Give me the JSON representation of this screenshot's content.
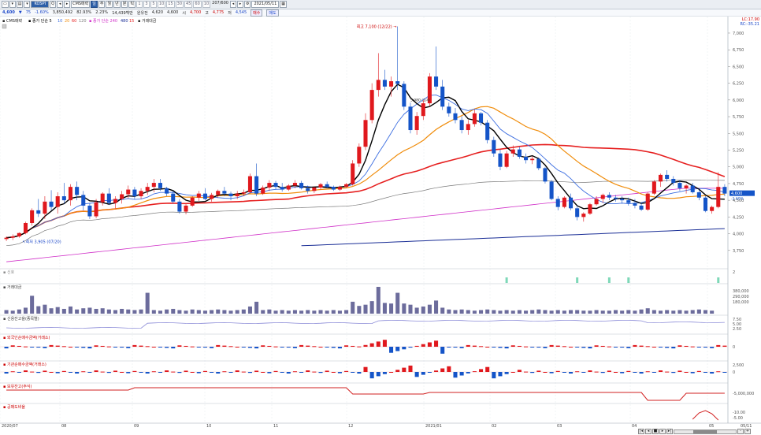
{
  "toolbar": {
    "symbol": "KOSPI",
    "kind": "CMS매략",
    "periods": [
      "1",
      "3",
      "5",
      "10",
      "15",
      "30",
      "45",
      "60",
      "10"
    ],
    "count": "207/600",
    "date": "2021/05/11",
    "dropdown_arrow": "▾"
  },
  "quote": {
    "price": "4,600",
    "direction": "▼",
    "change": "75",
    "pct": "-1.60%",
    "volume": "3,850,492",
    "vol_pct": "82.93%",
    "amount": "2.23%",
    "turnover": "14,439백만",
    "open_label": "원유전",
    "open": "4,620",
    "open2": "4,600",
    "high_label": "시",
    "high": "4,700",
    "low_label": "고",
    "low": "4,775",
    "close_label": "저",
    "close": "4,545",
    "btn1": "매도",
    "btn2": "매수"
  },
  "chart_data": {
    "type": "candlestick",
    "title": "CMS매략",
    "ylim": [
      3500,
      7200
    ],
    "yticks": [
      "7,000",
      "6,750",
      "6,500",
      "6,250",
      "6,000",
      "5,750",
      "5,500",
      "5,250",
      "5,000",
      "4,750",
      "4,500",
      "4,250",
      "4,000",
      "3,750"
    ],
    "ylim_note": "",
    "legend": [
      "CMS매략",
      "종가 단순 5",
      "10",
      "20",
      "60",
      "120",
      "종가 단순 240",
      "480",
      "15",
      "거래대금"
    ],
    "annotations": {
      "max": "최고 7,100 (12/22)",
      "min": "최저 3,905 (07/20)",
      "mid": "5,980 (1/4)"
    },
    "right_labels": [
      "LC:17.90",
      "RC:-35.21"
    ],
    "current_price_tag": "4,600",
    "current_pct_tag": "-1.60%",
    "x_labels": [
      "2020/07",
      "08",
      "09",
      "10",
      "11",
      "12",
      "2021/01",
      "02",
      "03",
      "04",
      "05",
      "05/11"
    ],
    "ohlc": [
      [
        3920,
        3960,
        3890,
        3940
      ],
      [
        3940,
        3990,
        3905,
        3960
      ],
      [
        3960,
        4020,
        3940,
        4010
      ],
      [
        4010,
        4180,
        3990,
        4160
      ],
      [
        4160,
        4380,
        4120,
        4350
      ],
      [
        4350,
        4520,
        4250,
        4300
      ],
      [
        4300,
        4560,
        4220,
        4480
      ],
      [
        4480,
        4650,
        4350,
        4400
      ],
      [
        4400,
        4620,
        4300,
        4560
      ],
      [
        4560,
        4760,
        4450,
        4500
      ],
      [
        4500,
        4740,
        4420,
        4700
      ],
      [
        4700,
        4780,
        4500,
        4580
      ],
      [
        4580,
        4640,
        4350,
        4420
      ],
      [
        4420,
        4460,
        4220,
        4260
      ],
      [
        4260,
        4520,
        4230,
        4470
      ],
      [
        4470,
        4620,
        4420,
        4600
      ],
      [
        4600,
        4680,
        4430,
        4460
      ],
      [
        4460,
        4560,
        4380,
        4520
      ],
      [
        4520,
        4640,
        4450,
        4590
      ],
      [
        4590,
        4720,
        4530,
        4660
      ],
      [
        4660,
        4700,
        4520,
        4560
      ],
      [
        4560,
        4680,
        4520,
        4640
      ],
      [
        4640,
        4760,
        4580,
        4700
      ],
      [
        4700,
        4820,
        4620,
        4760
      ],
      [
        4760,
        4820,
        4640,
        4680
      ],
      [
        4680,
        4700,
        4560,
        4600
      ],
      [
        4600,
        4640,
        4450,
        4480
      ],
      [
        4480,
        4520,
        4300,
        4330
      ],
      [
        4330,
        4440,
        4290,
        4420
      ],
      [
        4420,
        4560,
        4400,
        4540
      ],
      [
        4540,
        4640,
        4490,
        4600
      ],
      [
        4600,
        4680,
        4500,
        4520
      ],
      [
        4520,
        4610,
        4480,
        4580
      ],
      [
        4580,
        4660,
        4540,
        4640
      ],
      [
        4640,
        4700,
        4560,
        4600
      ],
      [
        4600,
        4630,
        4500,
        4560
      ],
      [
        4560,
        4640,
        4520,
        4600
      ],
      [
        4600,
        4660,
        4560,
        4620
      ],
      [
        4620,
        4900,
        4600,
        4860
      ],
      [
        4860,
        5050,
        4560,
        4600
      ],
      [
        4600,
        4720,
        4580,
        4690
      ],
      [
        4690,
        4800,
        4640,
        4760
      ],
      [
        4760,
        4790,
        4660,
        4700
      ],
      [
        4700,
        4760,
        4630,
        4660
      ],
      [
        4660,
        4740,
        4640,
        4720
      ],
      [
        4720,
        4800,
        4680,
        4760
      ],
      [
        4760,
        4790,
        4660,
        4680
      ],
      [
        4680,
        4720,
        4600,
        4640
      ],
      [
        4640,
        4700,
        4610,
        4690
      ],
      [
        4690,
        4760,
        4660,
        4740
      ],
      [
        4740,
        4780,
        4680,
        4700
      ],
      [
        4700,
        4720,
        4640,
        4660
      ],
      [
        4660,
        4720,
        4640,
        4700
      ],
      [
        4700,
        4760,
        4690,
        4740
      ],
      [
        4740,
        5100,
        4720,
        5050
      ],
      [
        5050,
        5350,
        5000,
        5300
      ],
      [
        5300,
        5800,
        5250,
        5700
      ],
      [
        5700,
        6250,
        5650,
        6150
      ],
      [
        6150,
        6700,
        6050,
        6300
      ],
      [
        6300,
        6450,
        6150,
        6200
      ],
      [
        6200,
        6350,
        6050,
        6280
      ],
      [
        6280,
        7100,
        6150,
        6240
      ],
      [
        6240,
        6280,
        5850,
        5900
      ],
      [
        5900,
        5960,
        5500,
        5550
      ],
      [
        5550,
        5820,
        5480,
        5760
      ],
      [
        5760,
        6000,
        5700,
        5950
      ],
      [
        5950,
        6400,
        5900,
        6350
      ],
      [
        6350,
        6800,
        6150,
        6200
      ],
      [
        6200,
        6300,
        5850,
        5900
      ],
      [
        5900,
        5960,
        5750,
        5800
      ],
      [
        5800,
        5880,
        5650,
        5700
      ],
      [
        5700,
        5760,
        5500,
        5550
      ],
      [
        5550,
        5700,
        5480,
        5640
      ],
      [
        5640,
        5860,
        5600,
        5800
      ],
      [
        5800,
        5820,
        5620,
        5660
      ],
      [
        5660,
        5700,
        5350,
        5400
      ],
      [
        5400,
        5450,
        5150,
        5200
      ],
      [
        5200,
        5260,
        4950,
        5000
      ],
      [
        5000,
        5240,
        4980,
        5200
      ],
      [
        5200,
        5320,
        5150,
        5260
      ],
      [
        5260,
        5300,
        5120,
        5150
      ],
      [
        5150,
        5200,
        5050,
        5100
      ],
      [
        5100,
        5160,
        5040,
        5120
      ],
      [
        5120,
        5140,
        4950,
        4980
      ],
      [
        4980,
        5000,
        4750,
        4780
      ],
      [
        4780,
        4800,
        4500,
        4520
      ],
      [
        4520,
        4560,
        4350,
        4400
      ],
      [
        4400,
        4560,
        4380,
        4540
      ],
      [
        4540,
        4600,
        4350,
        4380
      ],
      [
        4380,
        4420,
        4200,
        4250
      ],
      [
        4250,
        4320,
        4180,
        4300
      ],
      [
        4300,
        4460,
        4280,
        4440
      ],
      [
        4440,
        4560,
        4420,
        4520
      ],
      [
        4520,
        4600,
        4460,
        4580
      ],
      [
        4580,
        4620,
        4500,
        4540
      ],
      [
        4540,
        4580,
        4480,
        4520
      ],
      [
        4520,
        4560,
        4450,
        4500
      ],
      [
        4500,
        4540,
        4420,
        4460
      ],
      [
        4460,
        4520,
        4380,
        4420
      ],
      [
        4420,
        4470,
        4340,
        4360
      ],
      [
        4360,
        4620,
        4340,
        4600
      ],
      [
        4600,
        4800,
        4580,
        4780
      ],
      [
        4780,
        4900,
        4700,
        4880
      ],
      [
        4880,
        4950,
        4780,
        4820
      ],
      [
        4820,
        4860,
        4720,
        4760
      ],
      [
        4760,
        4800,
        4640,
        4680
      ],
      [
        4680,
        4740,
        4600,
        4720
      ],
      [
        4720,
        4760,
        4600,
        4620
      ],
      [
        4620,
        4660,
        4500,
        4540
      ],
      [
        4540,
        4560,
        4320,
        4340
      ],
      [
        4340,
        4420,
        4300,
        4400
      ],
      [
        4400,
        4920,
        4380,
        4700
      ],
      [
        4700,
        4740,
        4560,
        4600
      ]
    ],
    "volume": [
      12,
      10,
      14,
      20,
      60,
      25,
      30,
      18,
      22,
      16,
      24,
      14,
      18,
      20,
      16,
      18,
      14,
      12,
      16,
      14,
      12,
      14,
      70,
      12,
      10,
      14,
      16,
      12,
      10,
      14,
      12,
      10,
      12,
      14,
      12,
      10,
      12,
      14,
      24,
      40,
      12,
      14,
      10,
      12,
      10,
      12,
      10,
      12,
      10,
      12,
      10,
      12,
      10,
      12,
      40,
      26,
      30,
      42,
      90,
      36,
      34,
      70,
      34,
      30,
      20,
      24,
      30,
      44,
      20,
      14,
      12,
      14,
      12,
      10,
      12,
      14,
      12,
      10,
      12,
      10,
      12,
      10,
      12,
      14,
      12,
      10,
      12,
      10,
      12,
      12,
      10,
      10,
      12,
      10,
      10,
      12,
      10,
      12,
      10,
      14,
      18,
      12,
      10,
      12,
      10,
      12,
      10,
      12,
      14,
      12,
      10
    ],
    "vol_labels": [
      "380,000",
      "290,000",
      "180,000"
    ],
    "credit_labels": [
      "7.50",
      "5.00",
      "2.50"
    ],
    "foreign_labels": [
      "0"
    ],
    "inst_labels": [
      "2,500",
      "0"
    ],
    "holdings_labels": [
      "-5,000,000"
    ],
    "short_labels": [
      "-10.00",
      "-5.00"
    ],
    "signal_labels": [
      "2"
    ],
    "panel_titles": [
      "신호",
      "거래대금",
      "신용잔고율(종목별)",
      "외국인순매수금액(거래소)",
      "기관순매수금액(거래소)",
      "보유잔고(주식)",
      "공매도비율"
    ]
  },
  "colors": {
    "up": "#e0181d",
    "down": "#1454c8",
    "ma5": "#000000",
    "ma10": "#3b6de0",
    "ma20": "#f08c0a",
    "ma60": "#e62020",
    "ma120": "#7a7a7a",
    "ma240": "#d030c8",
    "ma480": "#1a2e96",
    "volume": "#6c6c9c",
    "credit": "#8c8cd8",
    "holding": "#d22020",
    "signal": "#7ed8b8"
  }
}
